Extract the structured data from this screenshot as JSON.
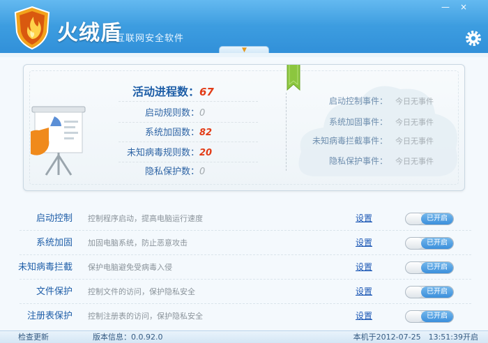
{
  "app": {
    "title": "火绒盾",
    "subtitle": "互联网安全软件",
    "minimize_glyph": "—",
    "close_glyph": "×",
    "logo_icon": "shield-flame-icon",
    "settings_icon": "gear-icon"
  },
  "colors": {
    "header": "#3d9de0",
    "stat_value": "#e23c17",
    "toggle_on": "#3b8fdc",
    "label_blue": "#1f5ea8"
  },
  "summary": {
    "stats": [
      {
        "label": "活动进程数：",
        "value": "67"
      },
      {
        "label": "启动规则数：",
        "value": "0"
      },
      {
        "label": "系统加固数：",
        "value": "82"
      },
      {
        "label": "未知病毒规则数：",
        "value": "20"
      },
      {
        "label": "隐私保护数：",
        "value": "0"
      }
    ],
    "events": [
      {
        "label": "启动控制事件：",
        "value": "今日无事件"
      },
      {
        "label": "系统加固事件：",
        "value": "今日无事件"
      },
      {
        "label": "未知病毒拦截事件：",
        "value": "今日无事件"
      },
      {
        "label": "隐私保护事件：",
        "value": "今日无事件"
      }
    ]
  },
  "features": [
    {
      "name": "启动控制",
      "desc": "控制程序启动，提高电脑运行速度",
      "settings": "设置",
      "toggle": "已开启"
    },
    {
      "name": "系统加固",
      "desc": "加固电脑系统，防止恶意攻击",
      "settings": "设置",
      "toggle": "已开启"
    },
    {
      "name": "未知病毒拦截",
      "desc": "保护电脑避免受病毒入侵",
      "settings": "设置",
      "toggle": "已开启"
    },
    {
      "name": "文件保护",
      "desc": "控制文件的访问，保护隐私安全",
      "settings": "设置",
      "toggle": "已开启"
    },
    {
      "name": "注册表保护",
      "desc": "控制注册表的访问，保护隐私安全",
      "settings": "设置",
      "toggle": "已开启"
    }
  ],
  "status": {
    "update": "检查更新",
    "version": "版本信息：0.0.92.0",
    "boot_time": "本机于2012-07-25　13:51:39开启"
  }
}
